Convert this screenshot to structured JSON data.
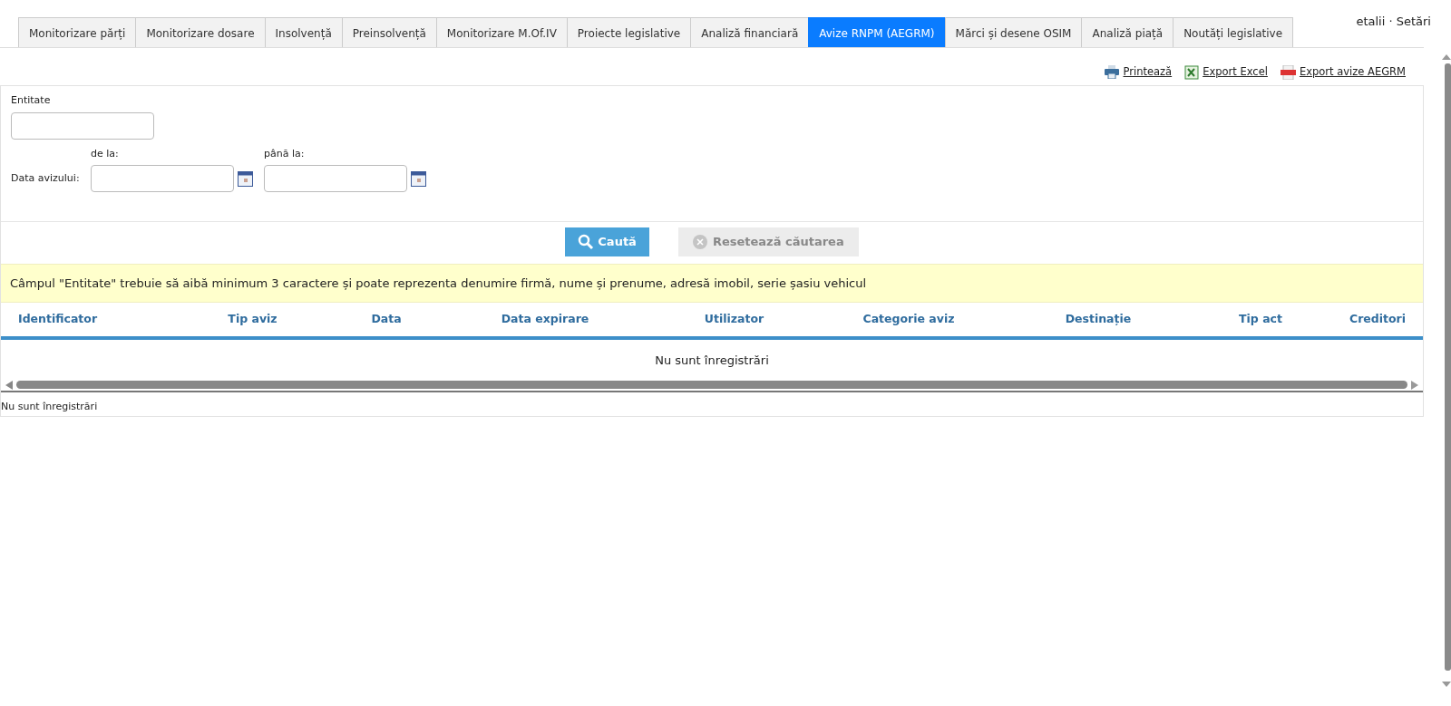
{
  "tabs": [
    {
      "label": "Monitorizare părți",
      "selected": false
    },
    {
      "label": "Monitorizare dosare",
      "selected": false
    },
    {
      "label": "Insolvență",
      "selected": false
    },
    {
      "label": "Preinsolvență",
      "selected": false
    },
    {
      "label": "Monitorizare M.Of.IV",
      "selected": false
    },
    {
      "label": "Proiecte legislative",
      "selected": false
    },
    {
      "label": "Analiză financiară",
      "selected": false
    },
    {
      "label": "Avize RNPM (AEGRM)",
      "selected": true
    },
    {
      "label": "Mărci și desene OSIM",
      "selected": false
    },
    {
      "label": "Analiză piață",
      "selected": false
    },
    {
      "label": "Noutăți legislative",
      "selected": false
    }
  ],
  "header_links": "etalii · Setări",
  "toolbar": [
    {
      "kind": "print",
      "label": "Printează"
    },
    {
      "kind": "excel",
      "label": "Export Excel"
    },
    {
      "kind": "pdf",
      "label": "Export avize AEGRM"
    }
  ],
  "filters": {
    "entity_label": "Entitate",
    "date_label": "Data avizului:",
    "from_label": "de la:",
    "to_label": "până la:"
  },
  "buttons": {
    "search": "Caută",
    "reset": "Resetează căutarea"
  },
  "notice": "Câmpul \"Entitate\" trebuie să aibă minimum 3 caractere și poate reprezenta denumire firmă, nume și prenume, adresă imobil, serie șasiu vehicul",
  "table": {
    "columns": [
      "Identificator",
      "Tip aviz",
      "Data",
      "Data expirare",
      "Utilizator",
      "Categorie aviz",
      "Destinație",
      "Tip act",
      "Creditori"
    ],
    "empty_message": "Nu sunt înregistrări"
  },
  "footer": "Nu sunt înregistrări"
}
